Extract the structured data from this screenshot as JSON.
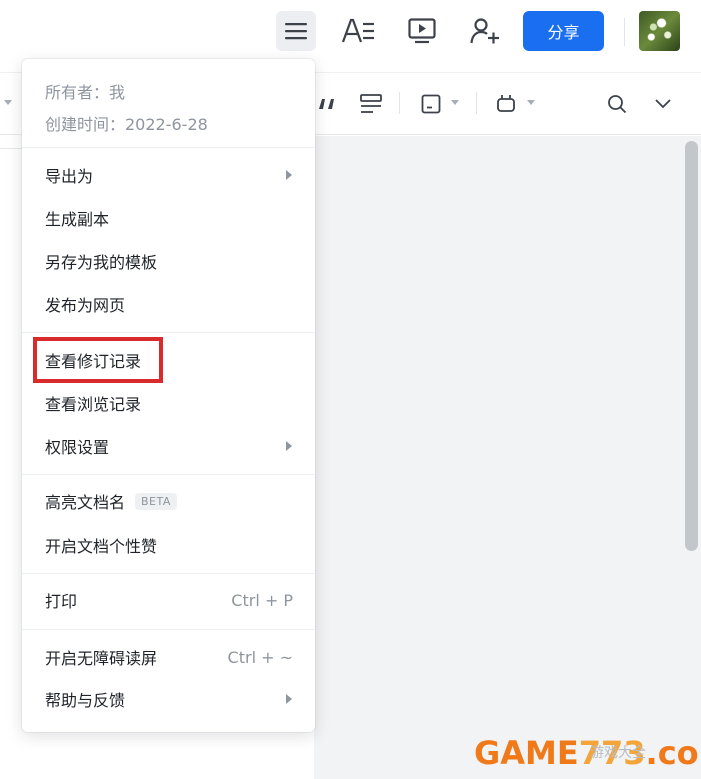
{
  "topbar": {
    "menu_icon": "hamburger-menu-icon",
    "font_icon": "text-format-icon",
    "present_icon": "presentation-icon",
    "adduser_icon": "add-user-icon",
    "share_label": "分享",
    "avatar_icon": "avatar-image"
  },
  "toolbar": {
    "tools": [
      "quote-icon",
      "align-icon",
      "card-icon",
      "plugin-icon",
      "search-icon",
      "expand-chevron-icon"
    ]
  },
  "menu": {
    "owner": "所有者：我",
    "created": "创建时间：2022-6-28",
    "items": [
      {
        "label": "导出为",
        "has_submenu": true
      },
      {
        "label": "生成副本"
      },
      {
        "label": "另存为我的模板"
      },
      {
        "label": "发布为网页"
      },
      {
        "label": "查看修订记录",
        "highlighted": true
      },
      {
        "label": "查看浏览记录"
      },
      {
        "label": "权限设置",
        "has_submenu": true
      },
      {
        "label": "高亮文档名",
        "badge": "BETA"
      },
      {
        "label": "开启文档个性赞"
      },
      {
        "label": "打印",
        "shortcut": "Ctrl + P"
      },
      {
        "label": "开启无障碍读屏",
        "shortcut": "Ctrl + ~"
      },
      {
        "label": "帮助与反馈",
        "has_submenu": true
      }
    ]
  },
  "watermark": {
    "brand_g": "GAME",
    "brand_n": "773",
    "brand_c": ".com",
    "sub": "游戏大全"
  },
  "colors": {
    "accent": "#1a6ff0",
    "highlight_border": "#d92b2b",
    "menu_button_bg": "#eceef1"
  }
}
